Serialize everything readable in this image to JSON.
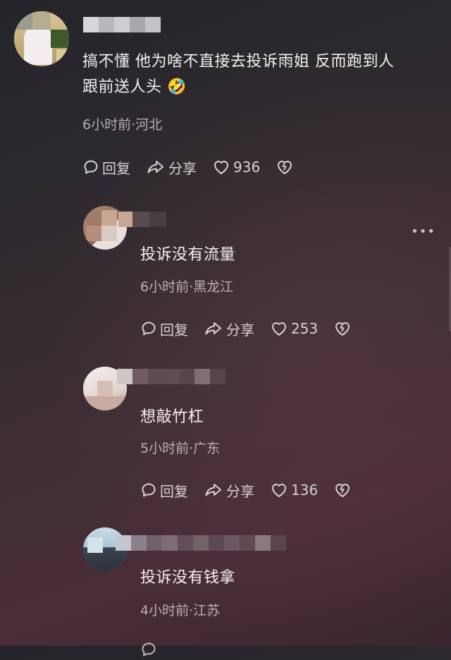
{
  "comments": [
    {
      "text_line1": "搞不懂 他为啥不直接去投诉雨姐 反而跑到人",
      "text_line2": "跟前送人头",
      "emoji": "🤣",
      "meta": "6小时前·河北",
      "reply_label": "回复",
      "share_label": "分享",
      "likes": "936"
    },
    {
      "text": "投诉没有流量",
      "meta": "6小时前·黑龙江",
      "reply_label": "回复",
      "share_label": "分享",
      "likes": "253"
    },
    {
      "text": "想敲竹杠",
      "meta": "5小时前·广东",
      "reply_label": "回复",
      "share_label": "分享",
      "likes": "136"
    },
    {
      "text": "投诉没有钱拿",
      "meta": "4小时前·江苏"
    }
  ],
  "more_icon": "more-dots-icon",
  "icons": [
    "reply-icon",
    "share-icon",
    "heart-icon",
    "dislike-heart-icon"
  ]
}
